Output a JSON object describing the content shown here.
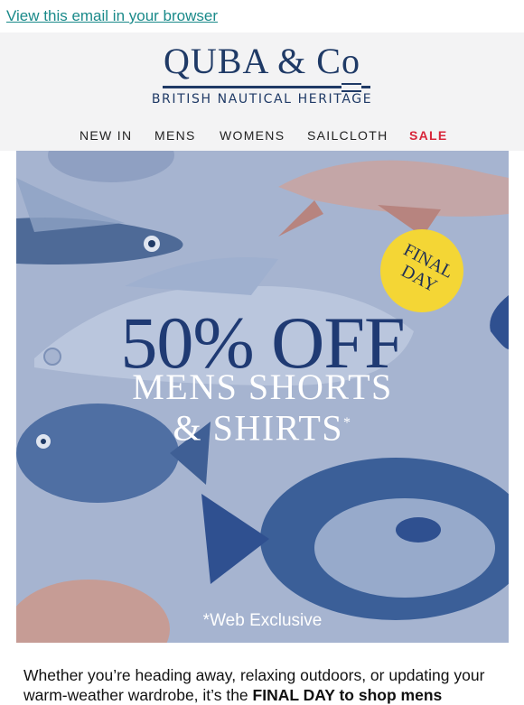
{
  "preheader": {
    "browser_link": "View this email in your browser"
  },
  "brand": {
    "name": "QUBA & Co",
    "tagline": "BRITISH NAUTICAL HERITAGE"
  },
  "nav": {
    "items": [
      "NEW IN",
      "MENS",
      "WOMENS",
      "SAILCLOTH",
      "SALE"
    ]
  },
  "hero": {
    "badge_line1": "FINAL",
    "badge_line2": "DAY",
    "headline": "50% OFF",
    "subline1": "MENS SHORTS",
    "subline2": "& SHIRTS",
    "subline2_mark": "*",
    "footnote": "*Web Exclusive"
  },
  "body": {
    "text_start": "Whether you’re heading away, relaxing outdoors, or updating your warm-weather wardrobe, it’s the ",
    "text_bold": "FINAL DAY to shop mens"
  },
  "colors": {
    "navy": "#1f3a66",
    "sale": "#d8263a",
    "hero_bg": "#a6b4d0",
    "badge": "#f4d635",
    "link": "#1a8a8a"
  }
}
